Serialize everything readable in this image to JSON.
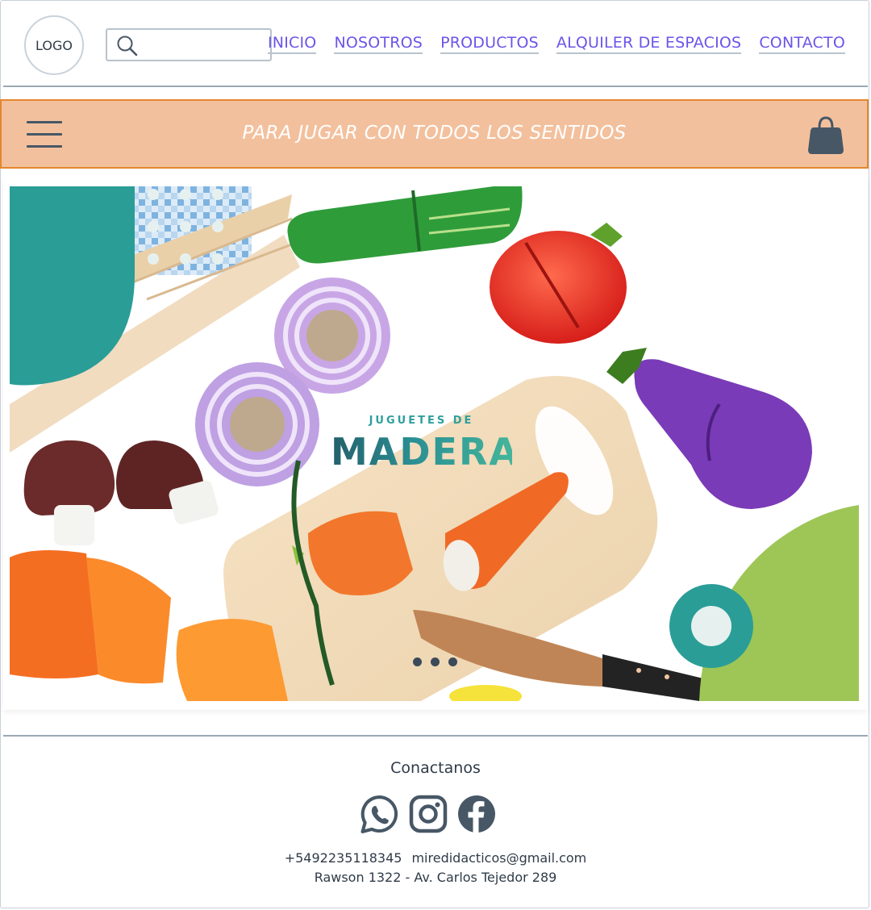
{
  "header": {
    "logo_text": "LOGO",
    "search": {
      "placeholder": "",
      "value": ""
    },
    "nav": [
      "INICIO",
      "NOSOTROS",
      "PRODUCTOS",
      "ALQUILER DE ESPACIOS",
      "CONTACTO"
    ]
  },
  "promo": {
    "slogan": "PARA JUGAR CON TODOS LOS SENTIDOS"
  },
  "hero": {
    "brand_small": "JUGUETES DE",
    "brand_big": "MADERA",
    "slides": 3
  },
  "footer": {
    "title": "Conactanos",
    "phone": "+5492235118345",
    "email": "miredidacticos@gmail.com",
    "address": "Rawson 1322 - Av. Carlos Tejedor 289",
    "social_icons": [
      "whatsapp-icon",
      "instagram-icon",
      "facebook-icon"
    ]
  },
  "colors": {
    "nav_link": "#6b55e8",
    "promo_bg": "#f3c09d",
    "promo_border": "#e3872f",
    "icon_dark": "#475766",
    "teal": "#2a9d97",
    "green": "#9dc657"
  }
}
